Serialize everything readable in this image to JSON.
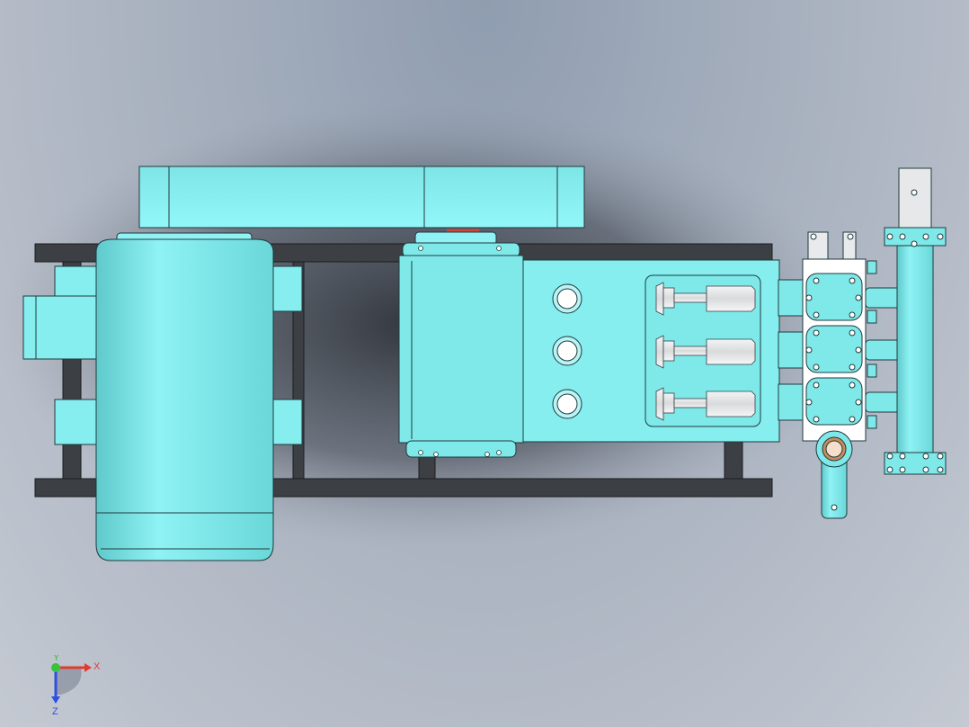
{
  "viewport": {
    "background_top": "#8f9db0",
    "background_bottom": "#c4c9d2"
  },
  "model": {
    "colors": {
      "body": "#7fe9ea",
      "body_light": "#98f6f8",
      "body_dark": "#5fc9cb",
      "outline": "#1f3a3d",
      "frame": "#3c3f44",
      "plunger": "#e6e7e8",
      "accent_red": "#d0453b",
      "bronze": "#c98a5a"
    }
  },
  "triad": {
    "x_label": "X",
    "y_label": "Y",
    "z_label": "Z",
    "x_color": "#e23a2f",
    "y_color": "#36c43b",
    "z_color": "#2f4fe0"
  }
}
